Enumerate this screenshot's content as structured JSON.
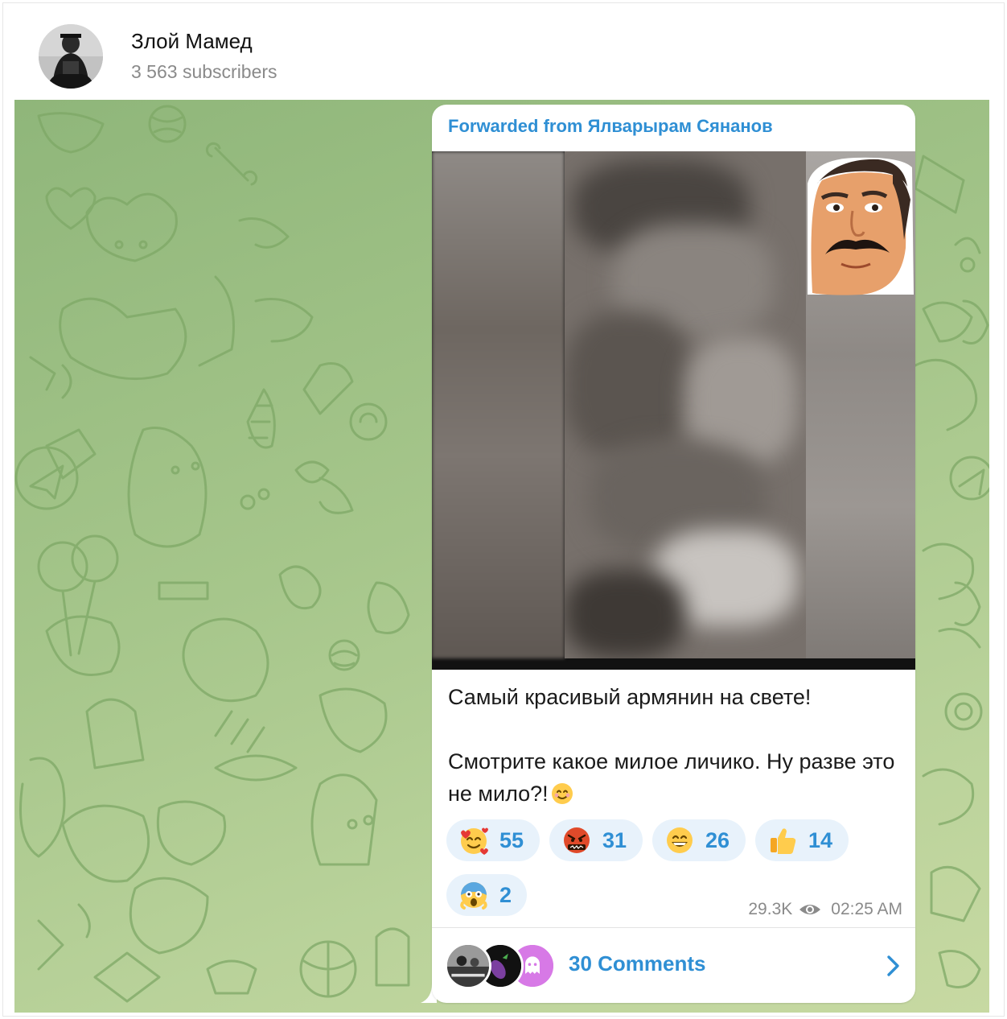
{
  "channel": {
    "title": "Злой Мамед",
    "subscribers": "3 563 subscribers"
  },
  "post": {
    "forwarded_label": "Forwarded from Ялварырам Сянанов",
    "caption_line1": "Самый красивый армянин на свете!",
    "caption_line2": "Смотрите какое милое личико. Ну разве это не мило?!",
    "caption_emoji": "smiling-face-icon",
    "reactions": [
      {
        "emoji": "smiling-face-with-hearts-icon",
        "count": "55"
      },
      {
        "emoji": "angry-face-with-symbols-icon",
        "count": "31"
      },
      {
        "emoji": "grinning-face-icon",
        "count": "26"
      },
      {
        "emoji": "thumbs-up-icon",
        "count": "14"
      },
      {
        "emoji": "screaming-face-icon",
        "count": "2"
      }
    ],
    "views": "29.3K",
    "time": "02:25 AM",
    "comments_label": "30 Comments"
  },
  "colors": {
    "accent": "#2f8fd4",
    "reaction_bg": "#e8f2fb",
    "chat_bg": "#a6c68b"
  }
}
